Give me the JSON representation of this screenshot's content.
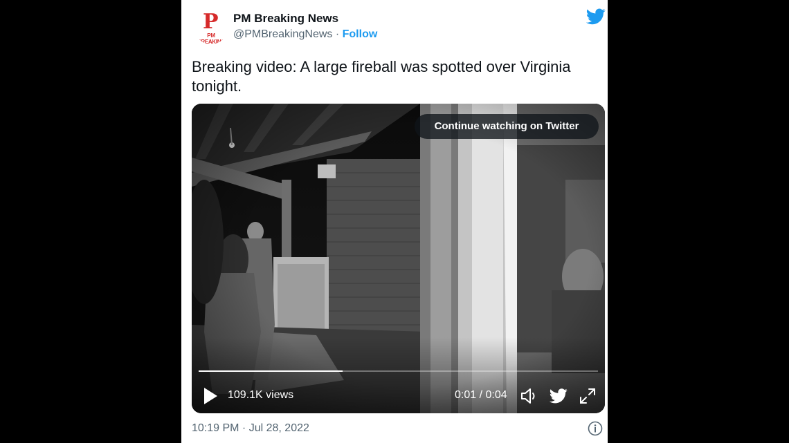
{
  "account": {
    "name": "PM Breaking News",
    "handle": "@PMBreakingNews",
    "separator": " · ",
    "follow_label": "Follow",
    "avatar_logo_letter": "P",
    "avatar_logo_text": "PM BREAKING"
  },
  "tweet": {
    "text": "Breaking video: A large fireball was spotted over Virginia tonight."
  },
  "video": {
    "continue_label": "Continue watching on Twitter",
    "views": "109.1K views",
    "time": "0:01 / 0:04",
    "progress": 0.36
  },
  "footer": {
    "timestamp": "10:19 PM · Jul 28, 2022"
  },
  "colors": {
    "twitter_blue": "#1d9bf0",
    "brand_red": "#d62a2a"
  },
  "icons": {
    "twitter": "twitter-bird-icon",
    "play": "play-icon",
    "volume": "volume-icon",
    "fullscreen": "fullscreen-icon",
    "info": "info-icon"
  }
}
